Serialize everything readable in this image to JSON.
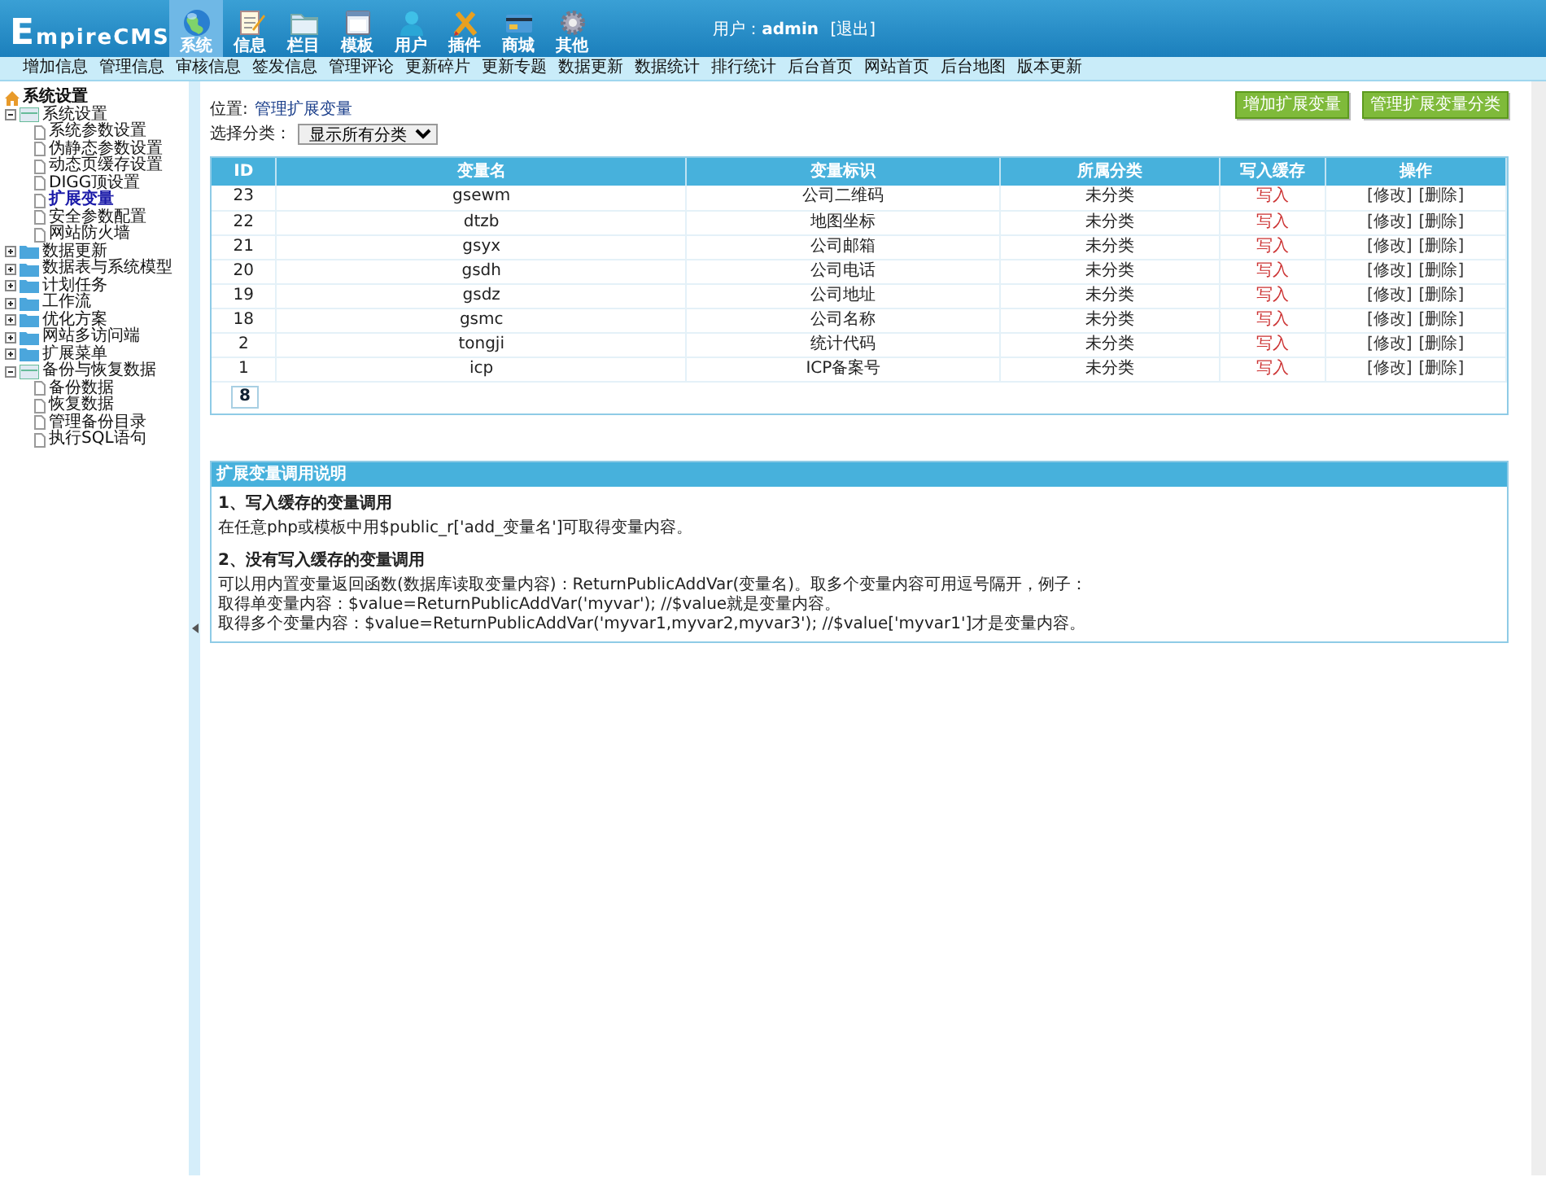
{
  "header": {
    "logo": "EmpireCMS",
    "user_label": "用户：",
    "user_name": "admin",
    "logout": "[退出]"
  },
  "nav_tabs": [
    {
      "label": "系统",
      "selected": true
    },
    {
      "label": "信息",
      "selected": false
    },
    {
      "label": "栏目",
      "selected": false
    },
    {
      "label": "模板",
      "selected": false
    },
    {
      "label": "用户",
      "selected": false
    },
    {
      "label": "插件",
      "selected": false
    },
    {
      "label": "商城",
      "selected": false
    },
    {
      "label": "其他",
      "selected": false
    }
  ],
  "sub_menu": [
    "增加信息",
    "管理信息",
    "审核信息",
    "签发信息",
    "管理评论",
    "更新碎片",
    "更新专题",
    "数据更新",
    "数据统计",
    "排行统计",
    "后台首页",
    "网站首页",
    "后台地图",
    "版本更新"
  ],
  "sidebar": {
    "title": "系统设置",
    "items": [
      {
        "label": "系统设置",
        "expanded": true,
        "children": [
          {
            "label": "系统参数设置",
            "selected": false
          },
          {
            "label": "伪静态参数设置",
            "selected": false
          },
          {
            "label": "动态页缓存设置",
            "selected": false
          },
          {
            "label": "DIGG顶设置",
            "selected": false
          },
          {
            "label": "扩展变量",
            "selected": true
          },
          {
            "label": "安全参数配置",
            "selected": false
          },
          {
            "label": "网站防火墙",
            "selected": false
          }
        ]
      },
      {
        "label": "数据更新",
        "expanded": false
      },
      {
        "label": "数据表与系统模型",
        "expanded": false
      },
      {
        "label": "计划任务",
        "expanded": false
      },
      {
        "label": "工作流",
        "expanded": false
      },
      {
        "label": "优化方案",
        "expanded": false
      },
      {
        "label": "网站多访问端",
        "expanded": false
      },
      {
        "label": "扩展菜单",
        "expanded": false
      },
      {
        "label": "备份与恢复数据",
        "expanded": true,
        "children": [
          {
            "label": "备份数据",
            "selected": false
          },
          {
            "label": "恢复数据",
            "selected": false
          },
          {
            "label": "管理备份目录",
            "selected": false
          },
          {
            "label": "执行SQL语句",
            "selected": false
          }
        ]
      }
    ]
  },
  "breadcrumb": {
    "label": "位置:",
    "link": "管理扩展变量"
  },
  "buttons": [
    "增加扩展变量",
    "管理扩展变量分类"
  ],
  "filter": {
    "label": "选择分类：",
    "value": "显示所有分类"
  },
  "table": {
    "columns": [
      "ID",
      "变量名",
      "变量标识",
      "所属分类",
      "写入缓存",
      "操作"
    ],
    "rows": [
      {
        "id": "23",
        "name": "gsewm",
        "mark": "公司二维码",
        "category": "未分类",
        "cache": "写入",
        "actions": [
          "[修改]",
          "[删除]"
        ]
      },
      {
        "id": "22",
        "name": "dtzb",
        "mark": "地图坐标",
        "category": "未分类",
        "cache": "写入",
        "actions": [
          "[修改]",
          "[删除]"
        ]
      },
      {
        "id": "21",
        "name": "gsyx",
        "mark": "公司邮箱",
        "category": "未分类",
        "cache": "写入",
        "actions": [
          "[修改]",
          "[删除]"
        ]
      },
      {
        "id": "20",
        "name": "gsdh",
        "mark": "公司电话",
        "category": "未分类",
        "cache": "写入",
        "actions": [
          "[修改]",
          "[删除]"
        ]
      },
      {
        "id": "19",
        "name": "gsdz",
        "mark": "公司地址",
        "category": "未分类",
        "cache": "写入",
        "actions": [
          "[修改]",
          "[删除]"
        ]
      },
      {
        "id": "18",
        "name": "gsmc",
        "mark": "公司名称",
        "category": "未分类",
        "cache": "写入",
        "actions": [
          "[修改]",
          "[删除]"
        ]
      },
      {
        "id": "2",
        "name": "tongji",
        "mark": "统计代码",
        "category": "未分类",
        "cache": "写入",
        "actions": [
          "[修改]",
          "[删除]"
        ]
      },
      {
        "id": "1",
        "name": "icp",
        "mark": "ICP备案号",
        "category": "未分类",
        "cache": "写入",
        "actions": [
          "[修改]",
          "[删除]"
        ]
      }
    ],
    "pager": "8"
  },
  "help": {
    "title": "扩展变量调用说明",
    "sections": [
      {
        "heading": "1、写入缓存的变量调用",
        "lines": [
          "在任意php或模板中用$public_r['add_变量名']可取得变量内容。"
        ]
      },
      {
        "heading": "2、没有写入缓存的变量调用",
        "lines": [
          "可以用内置变量返回函数(数据库读取变量内容)：ReturnPublicAddVar(变量名)。取多个变量内容可用逗号隔开，例子：",
          "取得单变量内容：$value=ReturnPublicAddVar('myvar'); //$value就是变量内容。",
          "取得多个变量内容：$value=ReturnPublicAddVar('myvar1,myvar2,myvar3'); //$value['myvar1']才是变量内容。"
        ]
      }
    ]
  }
}
